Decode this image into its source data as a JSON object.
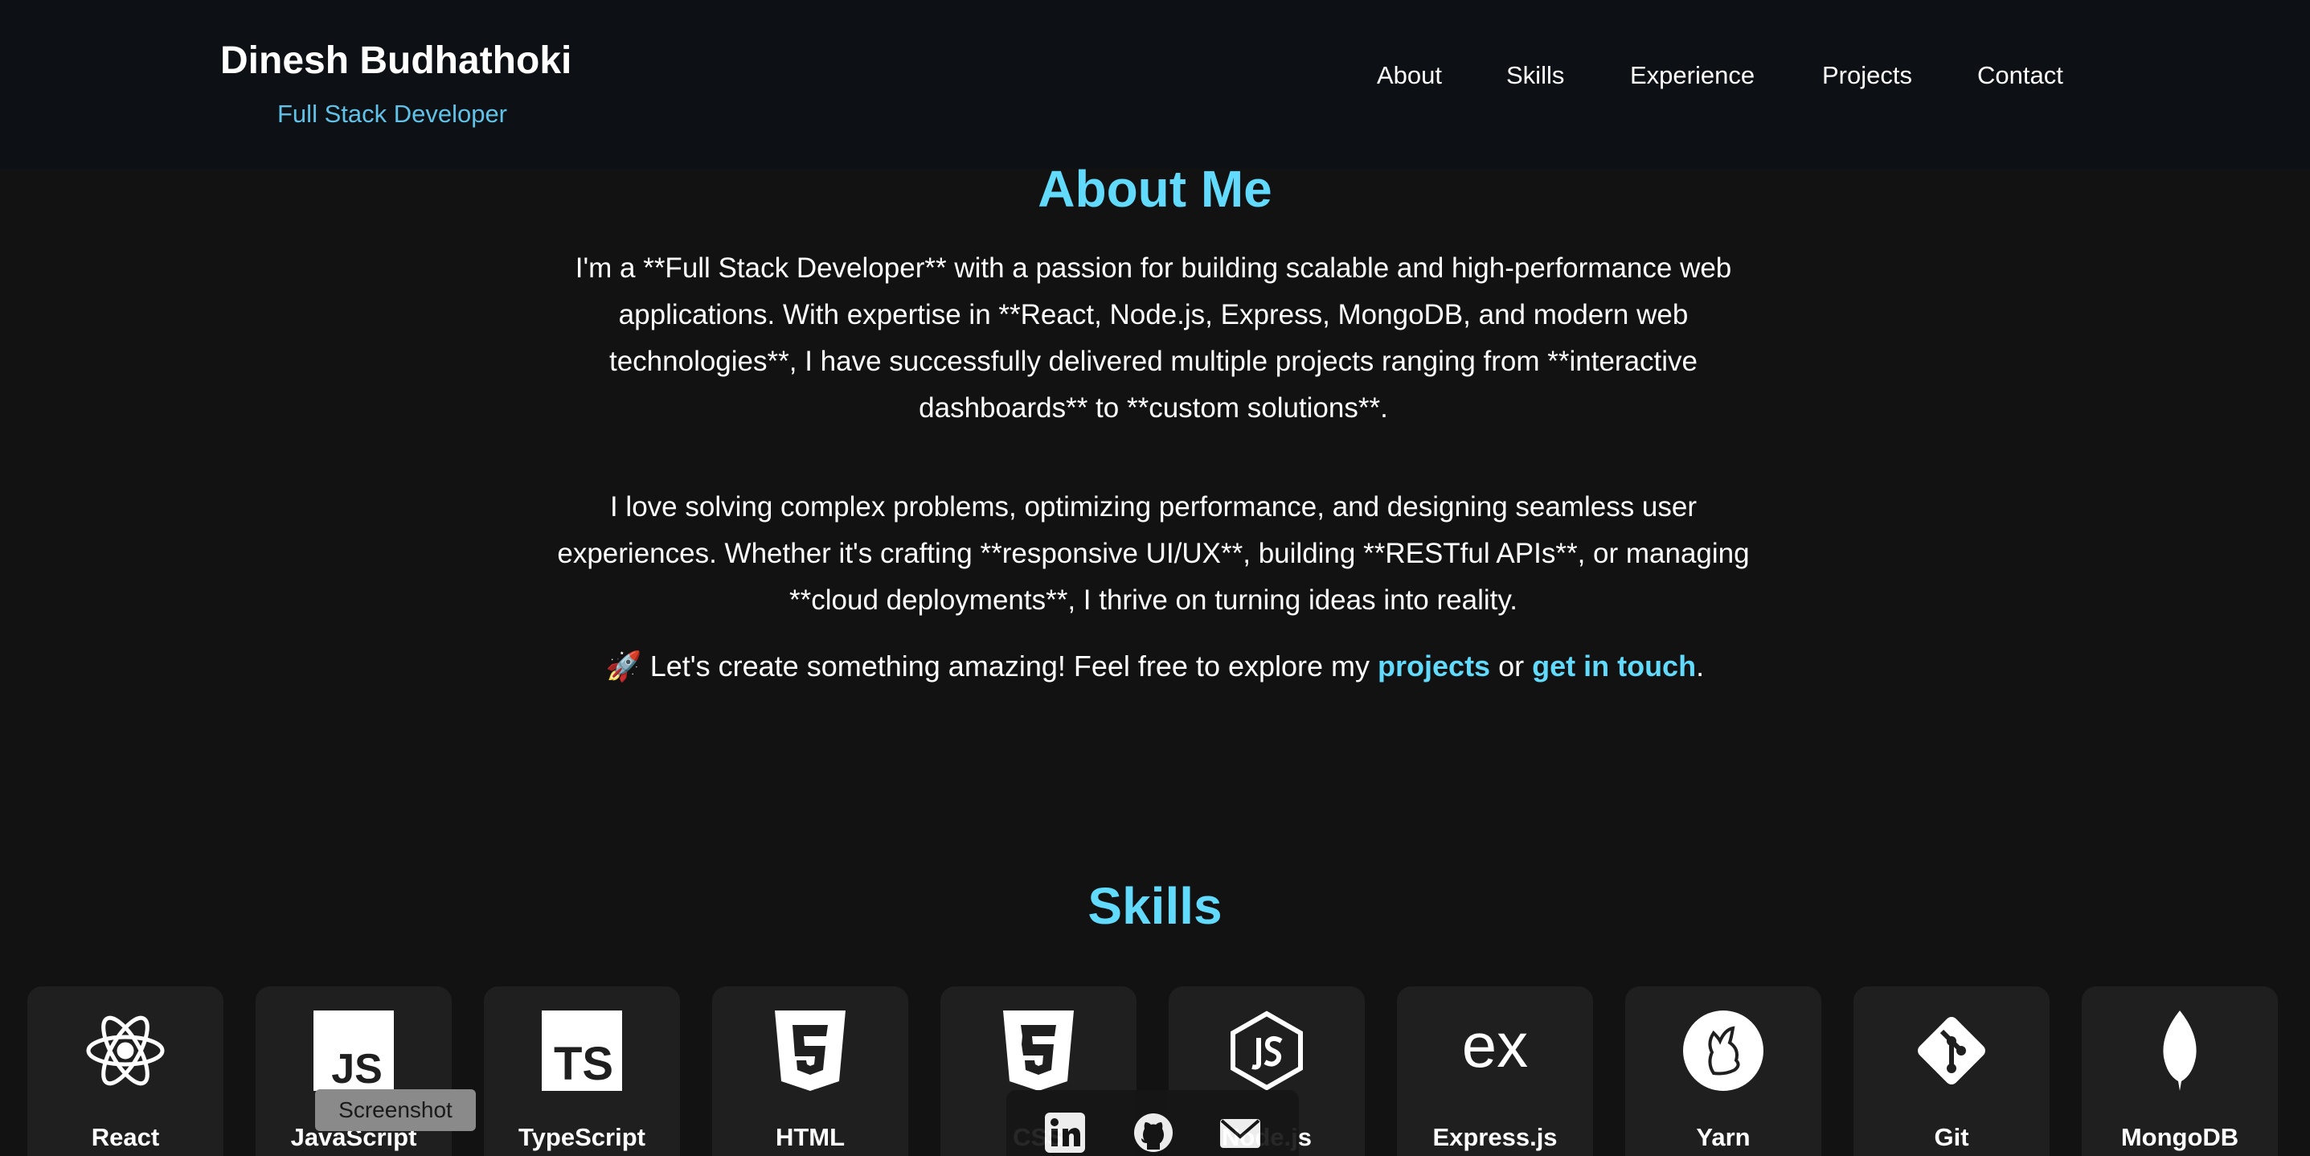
{
  "header": {
    "name": "Dinesh Budhathoki",
    "subtitle": "Full Stack Developer",
    "nav": [
      "About",
      "Skills",
      "Experience",
      "Projects",
      "Contact"
    ]
  },
  "about": {
    "title": "About Me",
    "paragraph1": "I'm a **Full Stack Developer** with a passion for building scalable and high-performance web applications. With expertise in **React, Node.js, Express, MongoDB, and modern web technologies**, I have successfully delivered multiple projects ranging from **interactive dashboards** to **custom solutions**.",
    "paragraph2": "I love solving complex problems, optimizing performance, and designing seamless user experiences. Whether it's crafting **responsive UI/UX**, building **RESTful APIs**, or managing **cloud deployments**, I thrive on turning ideas into reality.",
    "cta_prefix": "🚀 Let's create something amazing! Feel free to explore my ",
    "cta_projects": "projects",
    "cta_or": " or ",
    "cta_contact": "get in touch",
    "cta_suffix": "."
  },
  "skills": {
    "title": "Skills",
    "items": [
      {
        "label": "React",
        "icon": "react-icon"
      },
      {
        "label": "JavaScript",
        "icon": "javascript-icon"
      },
      {
        "label": "TypeScript",
        "icon": "typescript-icon"
      },
      {
        "label": "HTML",
        "icon": "html5-icon"
      },
      {
        "label": "CSS",
        "icon": "css3-icon"
      },
      {
        "label": "Node.js",
        "icon": "nodejs-icon"
      },
      {
        "label": "Express.js",
        "icon": "express-icon"
      },
      {
        "label": "Yarn",
        "icon": "yarn-icon"
      },
      {
        "label": "Git",
        "icon": "git-icon"
      },
      {
        "label": "MongoDB",
        "icon": "mongodb-icon"
      }
    ]
  },
  "social": [
    "linkedin-icon",
    "github-icon",
    "email-icon"
  ],
  "tooltip": "Screenshot",
  "colors": {
    "accent": "#61dafb",
    "subtitle": "#61c2e8",
    "background": "#121212",
    "header": "#0d1014",
    "card": "#1f1f1f"
  }
}
